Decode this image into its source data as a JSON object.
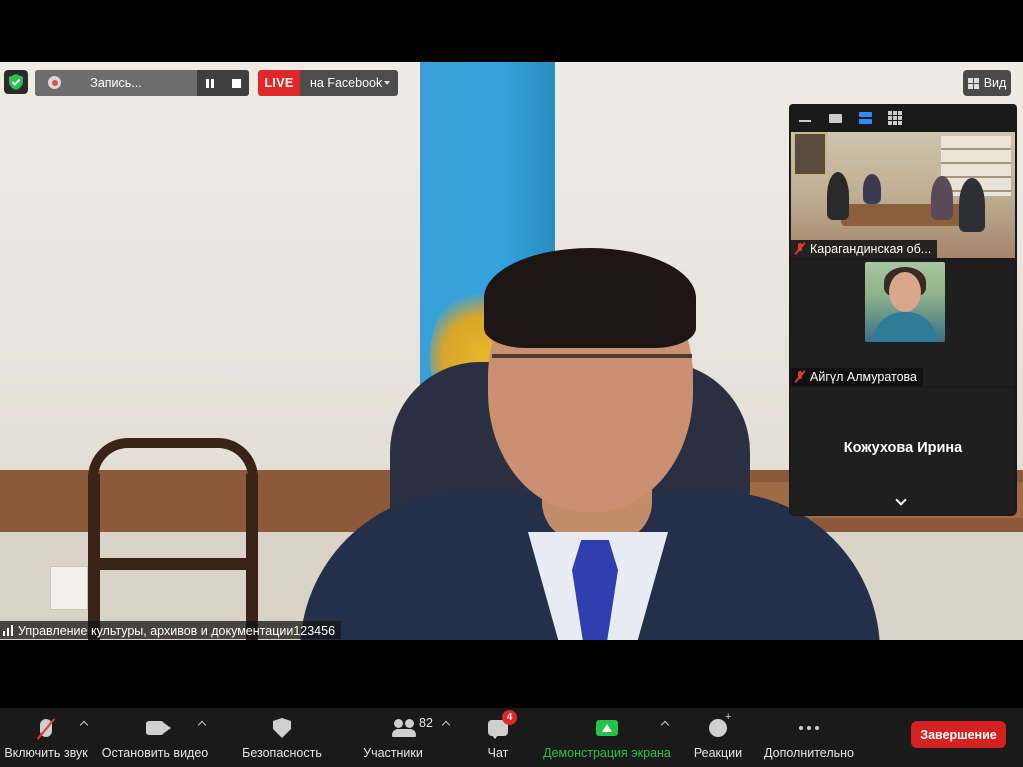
{
  "recording": {
    "label": "Запись..."
  },
  "live": {
    "badge": "LIVE",
    "target": "на Facebook"
  },
  "view": {
    "label": "Вид"
  },
  "main_video": {
    "speaker_name": "Управление культуры, архивов и документации123456"
  },
  "gallery": {
    "tiles": [
      {
        "name": "Карагандинская об...",
        "muted": true
      },
      {
        "name": "Айгүл Алмуратова",
        "muted": true
      },
      {
        "name": "Кожухова Ирина",
        "muted": true
      }
    ]
  },
  "toolbar": {
    "audio_label": "Включить звук",
    "video_label": "Остановить видео",
    "security_label": "Безопасность",
    "participants_label": "Участники",
    "participants_count": "82",
    "chat_label": "Чат",
    "chat_badge": "4",
    "share_label": "Демонстрация экрана",
    "reactions_label": "Реакции",
    "more_label": "Дополнительно",
    "end_label": "Завершение"
  },
  "colors": {
    "accent": "#2d8cff",
    "live": "#e02828",
    "share": "#27c24c",
    "end": "#d42222"
  },
  "icons": [
    "shield-icon",
    "record-icon",
    "pause-icon",
    "stop-icon",
    "view-grid-icon",
    "mic-muted-icon",
    "camera-icon",
    "security-shield-icon",
    "participants-icon",
    "chat-icon",
    "share-screen-icon",
    "reactions-icon",
    "more-icon"
  ]
}
